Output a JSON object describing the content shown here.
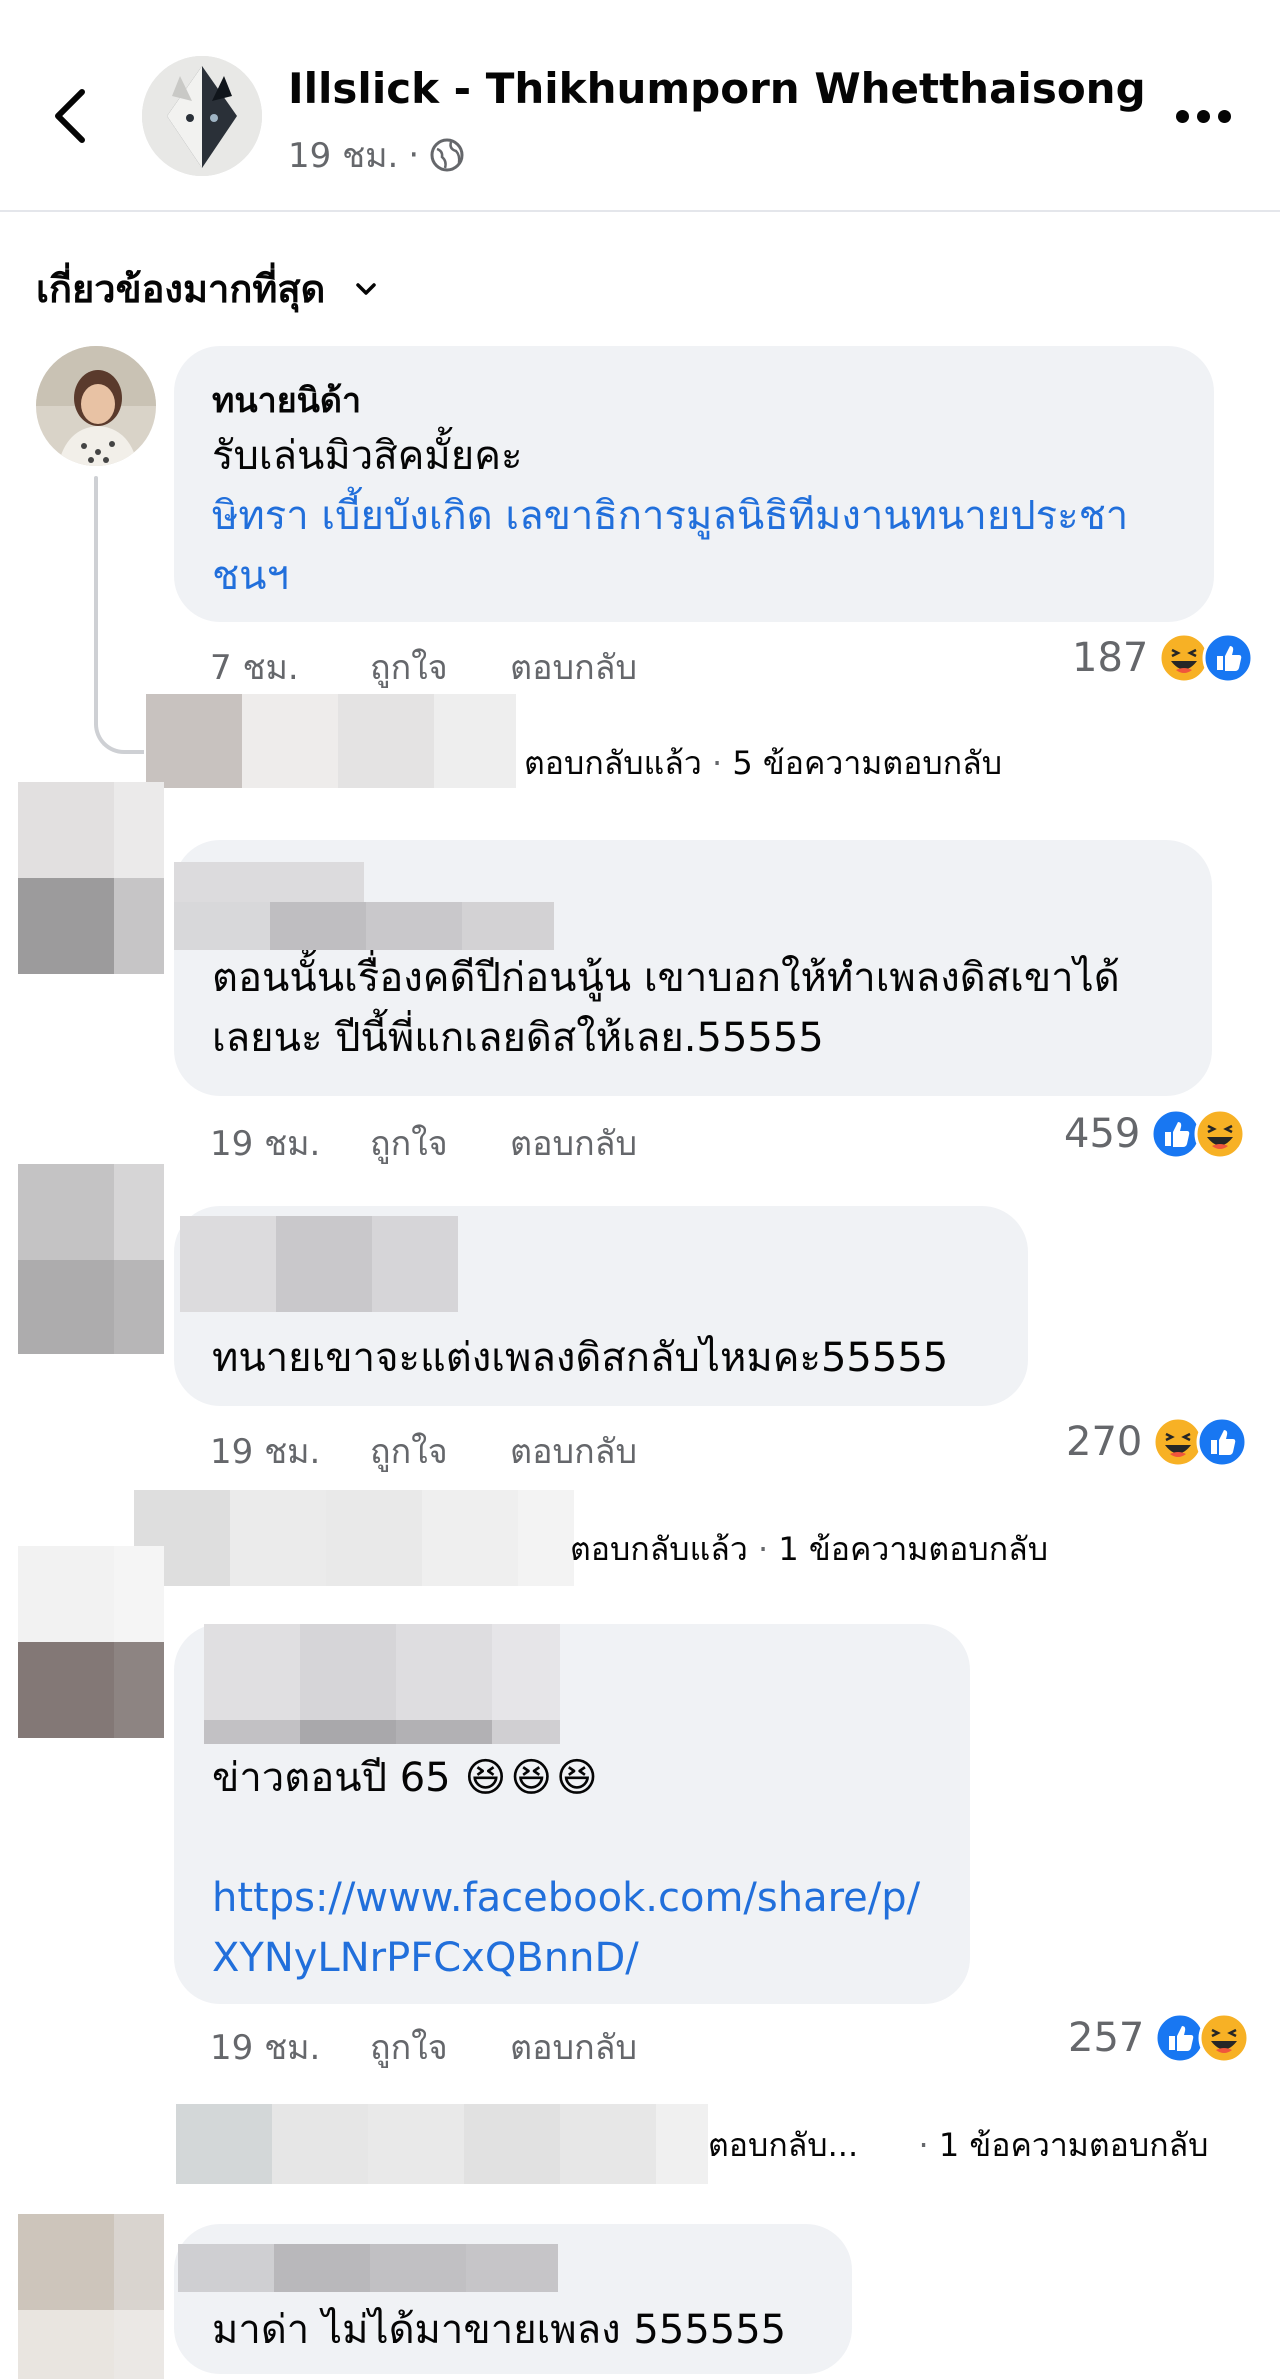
{
  "header": {
    "title": "Illslick - Thikhumporn Whetthaisong",
    "time": "19 ชม.",
    "separator": "·"
  },
  "sort": {
    "label": "เกี่ยวข้องมากที่สุด"
  },
  "comments": [
    {
      "name": "ทนายนิด้า",
      "text": "รับเล่นมิวสิคมั้ยคะ",
      "link_lines": [
        "ษิทรา เบี้ยบังเกิด เลขาธิการมูลนิธิทีมงานทนายประชา",
        "ชนฯ"
      ],
      "time": "7 ชม.",
      "like": "ถูกใจ",
      "reply": "ตอบกลับ",
      "reactions": "187",
      "reaction_icons": [
        "haha-icon",
        "like-icon"
      ]
    },
    {
      "text_lines": [
        "ตอนนั้นเรื่องคดีปีก่อนนู้น เขาบอกให้ทำเพลงดิสเขาได้",
        "เลยนะ ปีนี้พี่แกเลยดิสให้เลย.55555"
      ],
      "time": "19 ชม.",
      "like": "ถูกใจ",
      "reply": "ตอบกลับ",
      "reactions": "459",
      "reaction_icons": [
        "like-icon",
        "haha-icon"
      ]
    },
    {
      "text": "ทนายเขาจะแต่งเพลงดิสกลับไหมคะ55555",
      "time": "19 ชม.",
      "like": "ถูกใจ",
      "reply": "ตอบกลับ",
      "reactions": "270",
      "reaction_icons": [
        "haha-icon",
        "like-icon"
      ]
    },
    {
      "text": "ข่าวตอนปี 65",
      "emoji": "😆😆😆",
      "link_lines": [
        "https://www.facebook.com/share/p/",
        "XYNyLNrPFCxQBnnD/"
      ],
      "time": "19 ชม.",
      "like": "ถูกใจ",
      "reply": "ตอบกลับ",
      "reactions": "257",
      "reaction_icons": [
        "like-icon",
        "haha-icon"
      ]
    },
    {
      "text": "มาด่า ไม่ได้มาขายเพลง 555555"
    }
  ],
  "reply_summaries": [
    {
      "label": "ตอบกลับแล้ว",
      "sep": "·",
      "count": "5 ข้อความตอบกลับ"
    },
    {
      "label": "ตอบกลับแล้ว",
      "sep": "·",
      "count": "1 ข้อความตอบกลับ"
    },
    {
      "label": "ตอบกลับ...",
      "sep": "·",
      "count": "1 ข้อความตอบกลับ"
    }
  ],
  "colors": {
    "link": "#216fdb",
    "bubble": "#f0f2f5",
    "meta": "#65676b",
    "like_blue": "#1877f2",
    "haha_yellow": "#f7b125"
  }
}
